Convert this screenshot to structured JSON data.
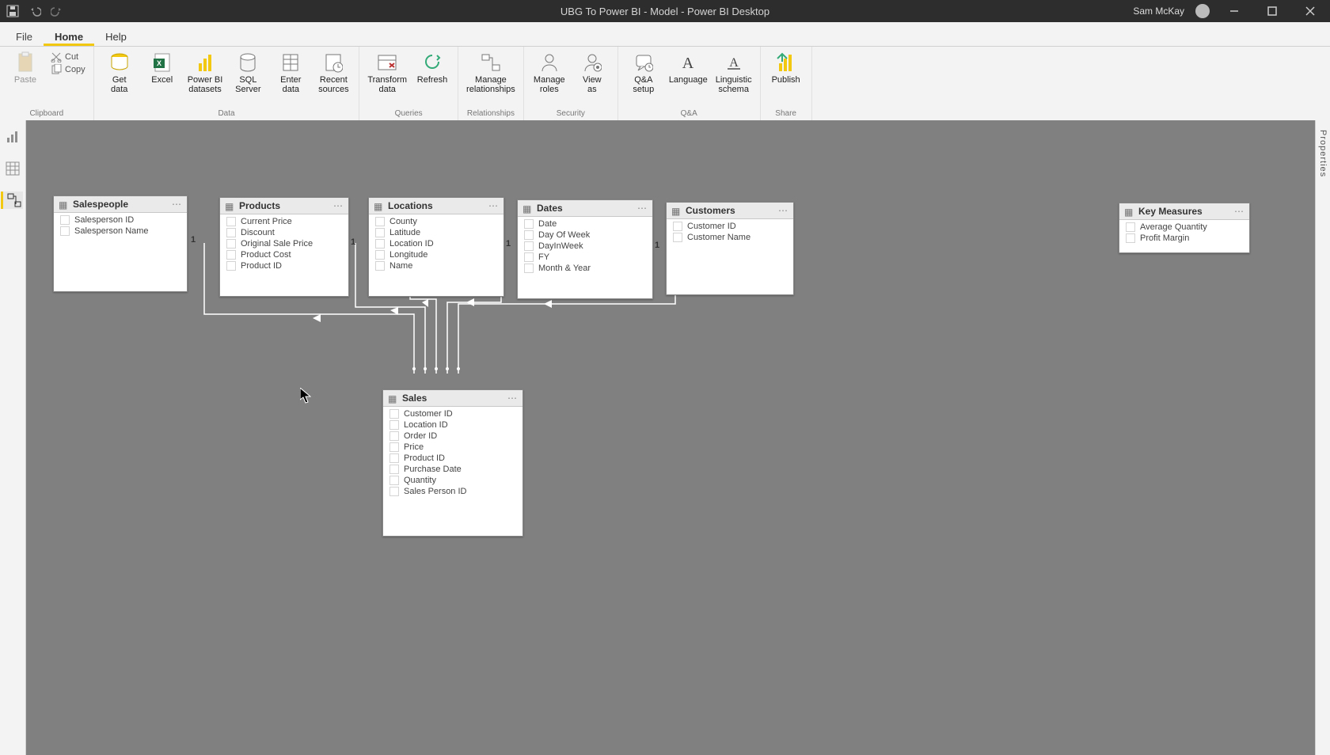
{
  "title": "UBG To Power BI - Model - Power BI Desktop",
  "user": "Sam McKay",
  "menu": {
    "file": "File",
    "home": "Home",
    "help": "Help"
  },
  "ribbon_groups": {
    "clipboard": {
      "caption": "Clipboard",
      "paste": "Paste",
      "cut": "Cut",
      "copy": "Copy"
    },
    "data": {
      "caption": "Data",
      "get": "Get\ndata",
      "excel": "Excel",
      "pbi": "Power BI\ndatasets",
      "sql": "SQL\nServer",
      "enter": "Enter\ndata",
      "recent": "Recent\nsources"
    },
    "queries": {
      "caption": "Queries",
      "transform": "Transform\ndata",
      "refresh": "Refresh"
    },
    "relationships": {
      "caption": "Relationships",
      "manage": "Manage\nrelationships"
    },
    "security": {
      "caption": "Security",
      "roles": "Manage\nroles",
      "view": "View\nas"
    },
    "qa": {
      "caption": "Q&A",
      "setup": "Q&A\nsetup",
      "lang": "Language",
      "schema": "Linguistic\nschema"
    },
    "share": {
      "caption": "Share",
      "publish": "Publish"
    }
  },
  "right_panel": "Properties",
  "tables": {
    "salespeople": {
      "name": "Salespeople",
      "fields": [
        "Salesperson ID",
        "Salesperson Name"
      ]
    },
    "products": {
      "name": "Products",
      "fields": [
        "Current Price",
        "Discount",
        "Original Sale Price",
        "Product Cost",
        "Product ID"
      ]
    },
    "locations": {
      "name": "Locations",
      "fields": [
        "County",
        "Latitude",
        "Location ID",
        "Longitude",
        "Name"
      ]
    },
    "dates": {
      "name": "Dates",
      "fields": [
        "Date",
        "Day Of Week",
        "DayInWeek",
        "FY",
        "Month & Year"
      ]
    },
    "customers": {
      "name": "Customers",
      "fields": [
        "Customer ID",
        "Customer Name"
      ]
    },
    "keymeasures": {
      "name": "Key Measures",
      "fields": [
        "Average Quantity",
        "Profit Margin"
      ]
    },
    "sales": {
      "name": "Sales",
      "fields": [
        "Customer ID",
        "Location ID",
        "Order ID",
        "Price",
        "Product ID",
        "Purchase Date",
        "Quantity",
        "Sales Person ID"
      ]
    }
  },
  "one_label": "1"
}
